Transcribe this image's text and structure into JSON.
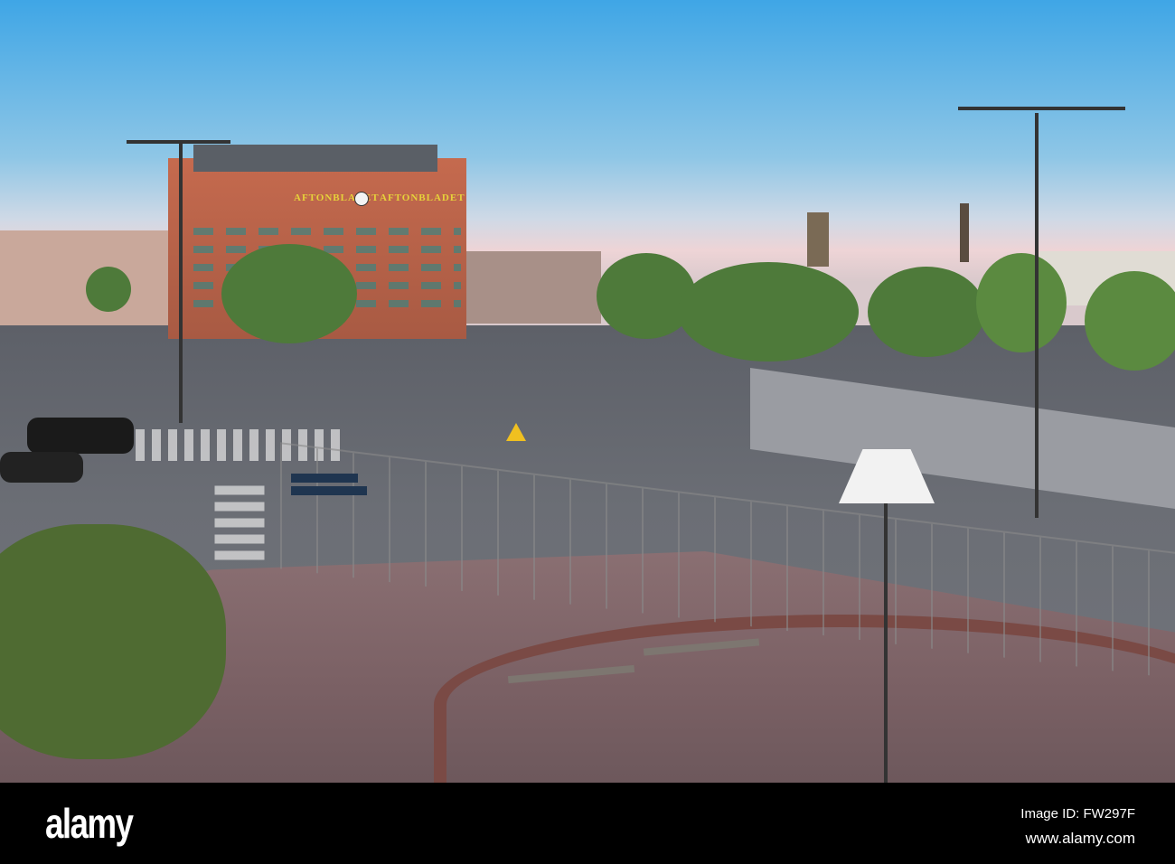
{
  "photo": {
    "building_sign": "AFTONBLADET",
    "colors": {
      "sky_top": "#3fa6e6",
      "sky_horizon": "#eed4d6",
      "building": "#c56a4e",
      "tree": "#4e7a3a"
    }
  },
  "watermark": {
    "logo": "alamy",
    "image_id": "Image ID: FW297F",
    "url": "www.alamy.com"
  }
}
